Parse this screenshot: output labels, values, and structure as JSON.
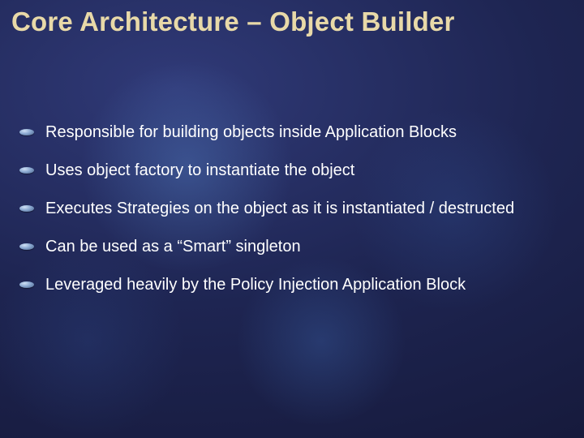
{
  "title": "Core Architecture – Object Builder",
  "bullets": [
    "Responsible for building objects inside Application Blocks",
    "Uses object factory to instantiate the object",
    "Executes Strategies on the object as it is instantiated / destructed",
    "Can be used as a “Smart” singleton",
    "Leveraged heavily by the Policy Injection Application Block"
  ]
}
